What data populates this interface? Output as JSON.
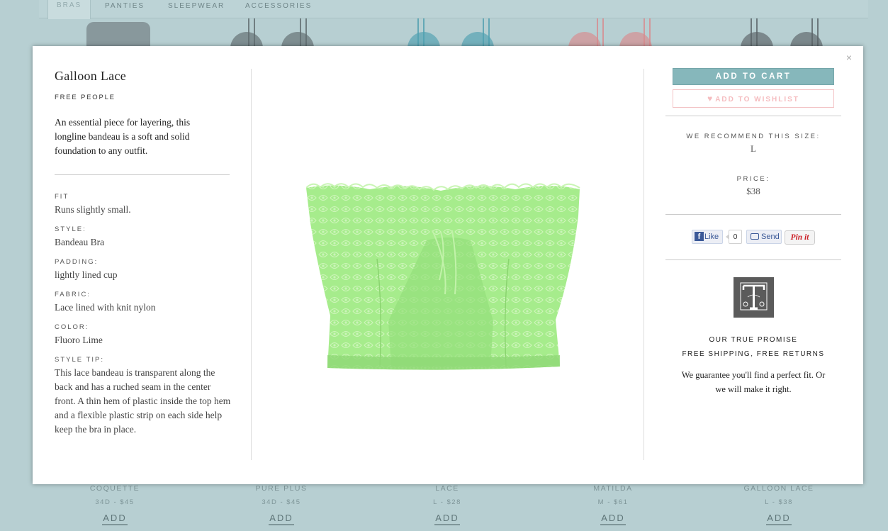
{
  "nav": {
    "tabs": [
      "BRAS",
      "PANTIES",
      "SLEEPWEAR",
      "ACCESSORIES"
    ]
  },
  "background_products": [
    {
      "name": "COQUETTE",
      "price": "34D - $45",
      "add_label": "ADD",
      "color": "#6e7b80"
    },
    {
      "name": "PURE PLUS",
      "price": "34D - $45",
      "add_label": "ADD",
      "color": "#5f6b6e"
    },
    {
      "name": "LACE",
      "price": "L - $28",
      "add_label": "ADD",
      "color": "#4f9fb0"
    },
    {
      "name": "MATILDA",
      "price": "M - $61",
      "add_label": "ADD",
      "color": "#d98a8e"
    },
    {
      "name": "GALLOON LACE",
      "price": "L - $38",
      "add_label": "ADD",
      "color": "#5a6367"
    }
  ],
  "modal": {
    "close_symbol": "×",
    "title": "Galloon Lace",
    "brand": "FREE PEOPLE",
    "description": "An essential piece for layering, this longline bandeau is a soft and solid foundation to any outfit.",
    "specs": [
      {
        "label": "FIT",
        "value": "Runs slightly small."
      },
      {
        "label": "STYLE:",
        "value": "Bandeau Bra"
      },
      {
        "label": "PADDING:",
        "value": "lightly lined cup"
      },
      {
        "label": "FABRIC:",
        "value": "Lace lined with knit nylon"
      },
      {
        "label": "COLOR:",
        "value": "Fluoro Lime"
      },
      {
        "label": "STYLE TIP:",
        "value": "This lace bandeau is transparent along the back and has a ruched seam in the center front. A thin hem of plastic inside the top hem and a flexible plastic strip on each side help keep the bra in place."
      }
    ],
    "product_color": "#a6ec8c",
    "add_to_cart_label": "ADD TO CART",
    "add_to_wishlist_label": "ADD TO WISHLIST",
    "recommend_label": "WE RECOMMEND THIS SIZE:",
    "recommended_size": "L",
    "price_label": "PRICE:",
    "price": "$38",
    "social": {
      "like_label": "Like",
      "like_count": "0",
      "send_label": "Send",
      "pin_label": "Pin it"
    },
    "promise_title": "OUR TRUE PROMISE",
    "promise_subtitle": "FREE SHIPPING, FREE RETURNS",
    "promise_text": "We guarantee you'll find a perfect fit. Or we will make it right."
  },
  "colors": {
    "accent": "#86b7bb",
    "wishlist": "#f5bcbf",
    "background": "#b7cfd2"
  }
}
